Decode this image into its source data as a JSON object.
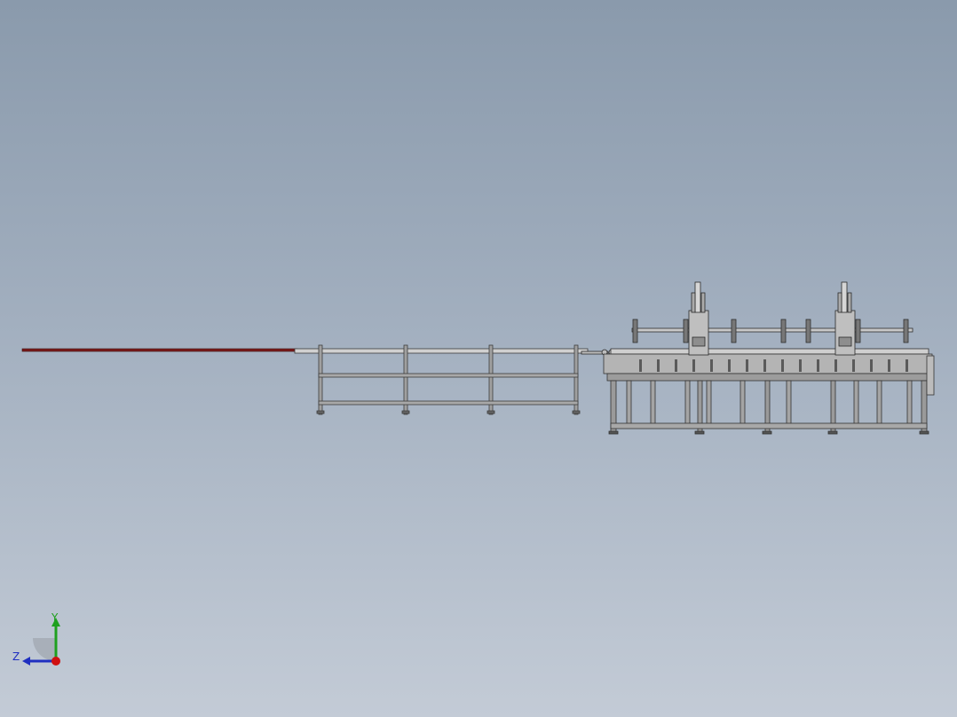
{
  "viewport": {
    "background_top": "#8a9aac",
    "background_bottom": "#c3cbd6"
  },
  "model": {
    "line_color": "#3c3c3c",
    "frame_fill": "#9a9a9a",
    "beam_fill": "#c8c8c8",
    "workpiece_color": "#7a1b1b"
  },
  "triad": {
    "y_label": "Y",
    "z_label": "Z",
    "y_color": "#1fa01f",
    "z_color": "#1f2fc0",
    "x_color": "#d01010"
  }
}
